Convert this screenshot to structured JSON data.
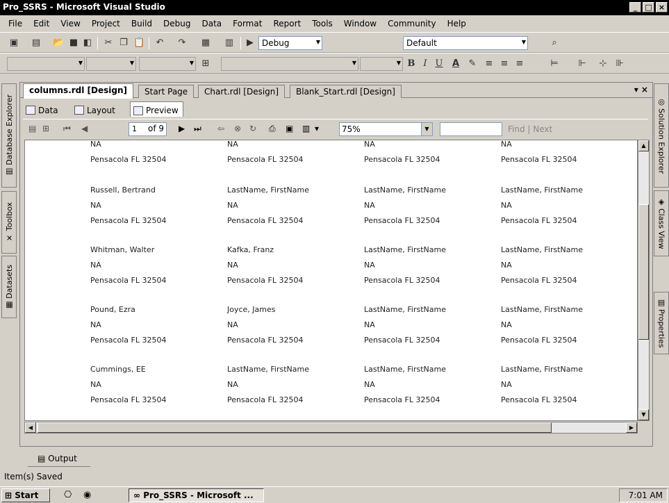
{
  "window": {
    "title": "Pro_SSRS - Microsoft Visual Studio"
  },
  "menu": [
    "File",
    "Edit",
    "View",
    "Project",
    "Build",
    "Debug",
    "Data",
    "Format",
    "Report",
    "Tools",
    "Window",
    "Community",
    "Help"
  ],
  "toolbar1": {
    "config": "Debug",
    "platform": "Default"
  },
  "toolbar2": {
    "bold": "B",
    "italic": "I",
    "underline": "U",
    "fontcolor": "A"
  },
  "side_left": [
    "Database Explorer",
    "Toolbox",
    "Datasets"
  ],
  "side_right": [
    "Solution Explorer",
    "Class View",
    "Properties"
  ],
  "doc_tabs": [
    "columns.rdl [Design]",
    "Start Page",
    "Chart.rdl [Design]",
    "Blank_Start.rdl [Design]"
  ],
  "sub_tabs": [
    "Data",
    "Layout",
    "Preview"
  ],
  "report_toolbar": {
    "page": "1",
    "of_pages": "of 9",
    "zoom": "75%",
    "find_next": "Find | Next"
  },
  "report_rows": [
    [
      [
        "NA",
        "Pensacola FL 32504"
      ],
      [
        "NA",
        "Pensacola FL 32504"
      ],
      [
        "NA",
        "Pensacola FL 32504"
      ],
      [
        "NA",
        "Pensacola FL 32504"
      ]
    ],
    [
      [
        "Russell, Bertrand",
        "NA",
        "Pensacola FL 32504"
      ],
      [
        "LastName, FirstName",
        "NA",
        "Pensacola FL 32504"
      ],
      [
        "LastName, FirstName",
        "NA",
        "Pensacola FL 32504"
      ],
      [
        "LastName, FirstName",
        "NA",
        "Pensacola FL 32504"
      ]
    ],
    [
      [
        "Whitman, Walter",
        "NA",
        "Pensacola FL 32504"
      ],
      [
        "Kafka, Franz",
        "NA",
        "Pensacola FL 32504"
      ],
      [
        "LastName, FirstName",
        "NA",
        "Pensacola FL 32504"
      ],
      [
        "LastName, FirstName",
        "NA",
        "Pensacola FL 32504"
      ]
    ],
    [
      [
        "Pound, Ezra",
        "NA",
        "Pensacola FL 32504"
      ],
      [
        "Joyce, James",
        "NA",
        "Pensacola FL 32504"
      ],
      [
        "LastName, FirstName",
        "NA",
        "Pensacola FL 32504"
      ],
      [
        "LastName, FirstName",
        "NA",
        "Pensacola FL 32504"
      ]
    ],
    [
      [
        "Cummings, EE",
        "NA",
        "Pensacola FL 32504"
      ],
      [
        "LastName, FirstName",
        "NA",
        "Pensacola FL 32504"
      ],
      [
        "LastName, FirstName",
        "NA",
        "Pensacola FL 32504"
      ],
      [
        "LastName, FirstName",
        "NA",
        "Pensacola FL 32504"
      ]
    ]
  ],
  "output_tab": "Output",
  "status": "Item(s) Saved",
  "taskbar": {
    "start": "Start",
    "item": "Pro_SSRS - Microsoft ...",
    "clock": "7:01 AM"
  }
}
